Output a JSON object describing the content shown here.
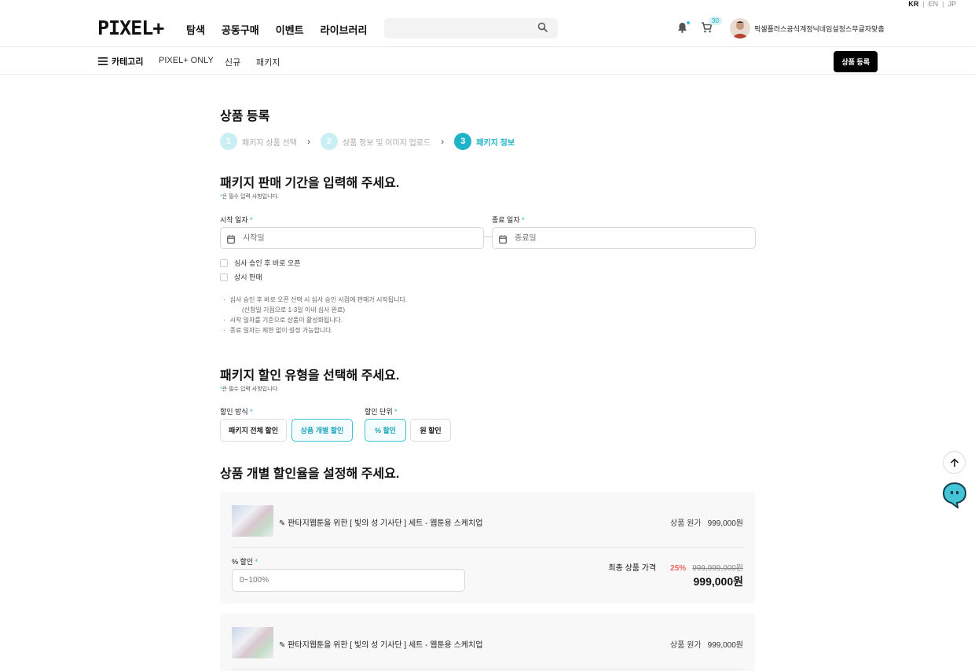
{
  "lang": {
    "kr": "KR",
    "en": "EN",
    "jp": "JP",
    "sep": "|"
  },
  "header": {
    "logo": "PIXEL+",
    "nav": [
      "탐색",
      "공동구매",
      "이벤트",
      "라이브러리"
    ],
    "search_placeholder": "",
    "cart_count": "30",
    "username": "픽셀플러스공식계정닉네임설정스무글자맞춤"
  },
  "subnav": {
    "category": "카테고리",
    "links": [
      "PIXEL+ ONLY",
      "신규",
      "패키지"
    ],
    "register_button": "상품 등록"
  },
  "page": {
    "title": "상품 등록",
    "steps": [
      {
        "num": "1",
        "label": "패키지 상품 선택"
      },
      {
        "num": "2",
        "label": "상품 정보 및 이미지 업로드"
      },
      {
        "num": "3",
        "label": "패키지 정보"
      }
    ]
  },
  "period": {
    "title": "패키지 판매 기간을 입력해 주세요.",
    "req_star": "*",
    "req_note": "은 필수 입력 사항입니다.",
    "start_label": "시작 일자",
    "start_placeholder": "시작일",
    "end_label": "종료 일자",
    "end_placeholder": "종료일",
    "checkbox_open": "심사 승인 후 바로 오픈",
    "checkbox_always": "상시 판매",
    "notes": [
      "심사 승인 후 바로 오픈 선택 시 심사 승인 시점에 판매가 시작됩니다.",
      "(신청일 기점으로 1-3일 이내 심사 완료)",
      "시작 일자를 기준으로 상품이 활성화됩니다.",
      "종료 일자는 제한 없이 설정 가능합니다."
    ]
  },
  "discount": {
    "title": "패키지 할인 유형을 선택해 주세요.",
    "req_note": "은 필수 입력 사항입니다.",
    "method_label": "할인 방식",
    "method_options": [
      "패키지 전체 할인",
      "상품 개별 할인"
    ],
    "method_selected": "상품 개별 할인",
    "unit_label": "할인 단위",
    "unit_options": [
      "% 할인",
      "원 할인"
    ],
    "unit_selected": "% 할인"
  },
  "individual": {
    "title": "상품 개별 할인율을 설정해 주세요.",
    "items": [
      {
        "name": "판타지웹툰을 위한 [ 빛의 성 기사단 ] 세트 - 웹툰용 스케치업",
        "orig_price_label": "상품 원가",
        "orig_price": "999,000원",
        "pct_label": "% 할인",
        "pct_placeholder": "0~100%",
        "final_label": "최종 상품 가격",
        "rate": "25%",
        "strike_price": "999,999,000원",
        "final_price": "999,000원"
      },
      {
        "name": "판타지웹툰을 위한 [ 빛의 성 기사단 ] 세트 - 웹툰용 스케치업",
        "orig_price_label": "상품 원가",
        "orig_price": "999,000원"
      }
    ]
  },
  "colors": {
    "accent": "#1fb3c9",
    "accent_light": "#c9eef3",
    "discount_red": "#f16a5a"
  }
}
